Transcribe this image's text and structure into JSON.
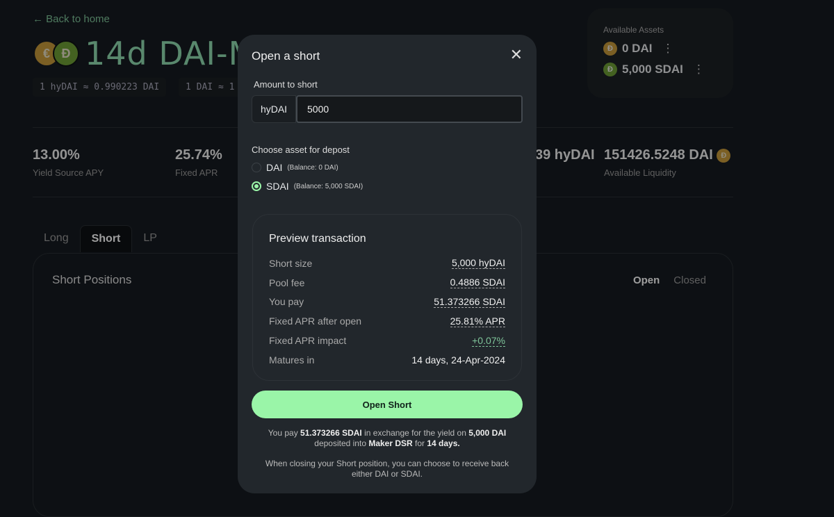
{
  "header": {
    "back": "← Back to home",
    "title": "14d DAI-M",
    "rates": [
      "1 hyDAI ≈ 0.990223 DAI",
      "1 DAI ≈ 1"
    ]
  },
  "stats": [
    {
      "value": "13.00%",
      "label": "Yield Source APY"
    },
    {
      "value": "25.74%",
      "label": "Fixed APR"
    },
    {
      "value": "39 hyDAI",
      "label": ""
    },
    {
      "value": "151426.5248 DAI",
      "label": "Available Liquidity"
    }
  ],
  "assets": {
    "heading": "Available Assets",
    "items": [
      {
        "amount": "0 DAI",
        "color": "#c79a3a"
      },
      {
        "amount": "5,000 SDAI",
        "color": "#6e9e36"
      }
    ]
  },
  "tabs": [
    "Long",
    "Short",
    "LP"
  ],
  "card": {
    "title": "Short Positions",
    "filters": [
      "Open",
      "Closed"
    ]
  },
  "modal": {
    "title": "Open a short",
    "amount_label": "Amount to short",
    "token": "hyDAI",
    "amount_value": "5000",
    "choose_label": "Choose asset for depost",
    "options": [
      {
        "name": "DAI",
        "balance": "(Balance: 0 DAI)",
        "selected": false
      },
      {
        "name": "SDAI",
        "balance": "(Balance: 5,000 SDAI)",
        "selected": true
      }
    ],
    "preview": {
      "title": "Preview transaction",
      "rows": [
        {
          "k": "Short size",
          "v": "5,000 hyDAI"
        },
        {
          "k": "Pool fee",
          "v": "0.4886 SDAI"
        },
        {
          "k": "You pay",
          "v": "51.373266 SDAI"
        },
        {
          "k": "Fixed APR after open",
          "v": "25.81% APR"
        },
        {
          "k": "Fixed APR impact",
          "v": "+0.07%"
        },
        {
          "k": "Matures in",
          "v": "14 days, 24-Apr-2024"
        }
      ]
    },
    "button": "Open Short",
    "note1": {
      "a": "You pay ",
      "b": "51.373266 SDAI",
      "c": " in exchange for the yield on ",
      "d": "5,000 DAI",
      "e": " deposited into ",
      "f": "Maker DSR",
      "g": " for ",
      "h": "14 days."
    },
    "note2": "When closing your Short position, you can choose to receive back either DAI or SDAI."
  },
  "colors": {
    "accent": "#9af5a8",
    "positive": "#7fc59a",
    "modal_bg": "#22272c",
    "page_bg": "#0d1014"
  }
}
